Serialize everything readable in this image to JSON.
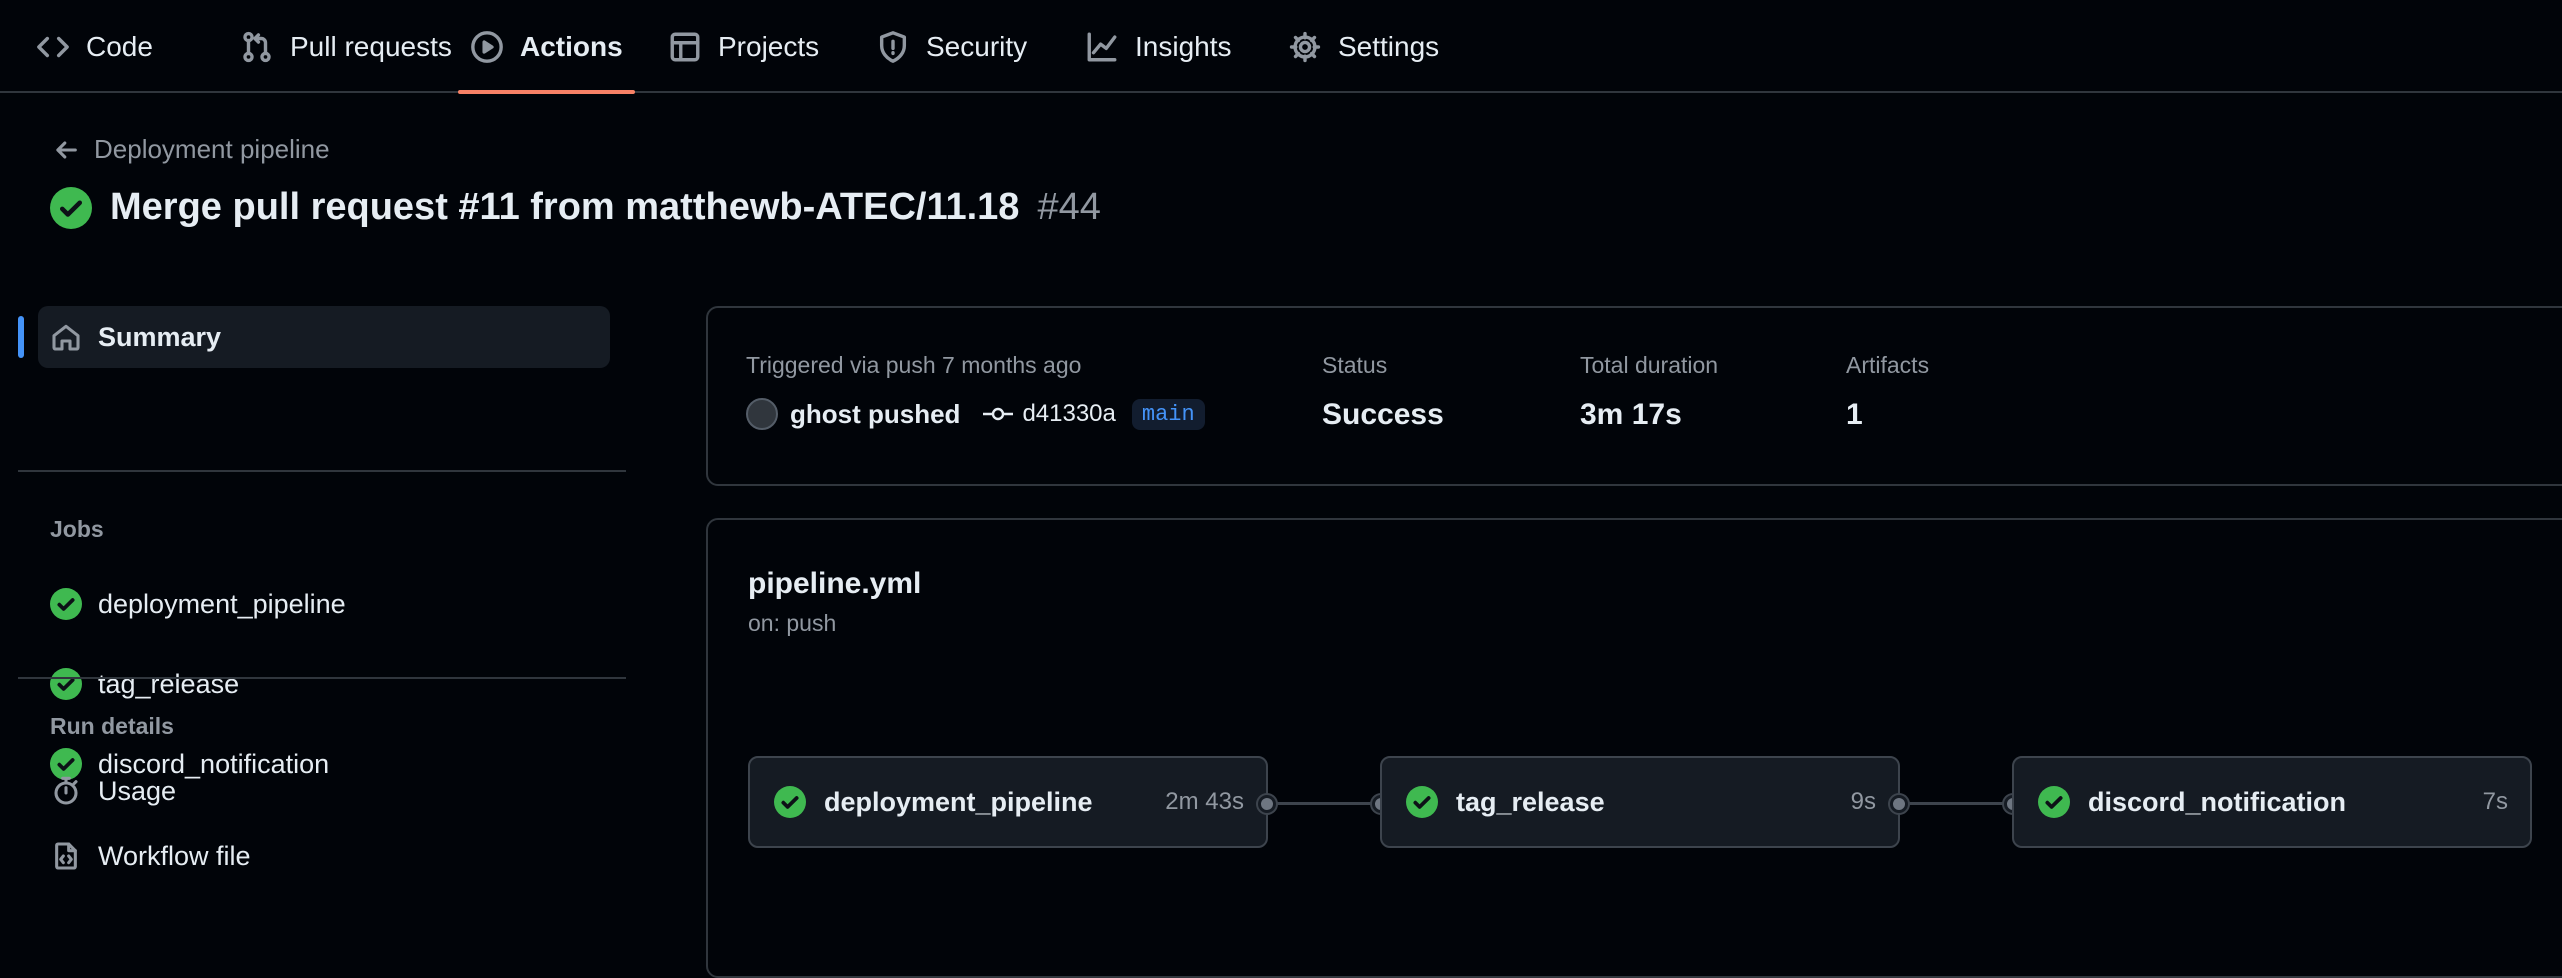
{
  "nav": {
    "tabs": [
      {
        "label": "Code",
        "icon": "code-icon"
      },
      {
        "label": "Pull requests",
        "icon": "git-pull-request-icon"
      },
      {
        "label": "Actions",
        "icon": "play-icon",
        "active": true
      },
      {
        "label": "Projects",
        "icon": "table-icon"
      },
      {
        "label": "Security",
        "icon": "shield-icon"
      },
      {
        "label": "Insights",
        "icon": "graph-icon"
      },
      {
        "label": "Settings",
        "icon": "gear-icon"
      }
    ]
  },
  "header": {
    "back_label": "Deployment pipeline",
    "title": "Merge pull request #11 from matthewb-ATEC/11.18",
    "run_number": "#44"
  },
  "sidebar": {
    "summary_label": "Summary",
    "jobs_heading": "Jobs",
    "jobs": [
      {
        "label": "deployment_pipeline",
        "status": "success"
      },
      {
        "label": "tag_release",
        "status": "success"
      },
      {
        "label": "discord_notification",
        "status": "success"
      }
    ],
    "run_details_heading": "Run details",
    "run_details": [
      {
        "label": "Usage",
        "icon": "stopwatch-icon"
      },
      {
        "label": "Workflow file",
        "icon": "file-code-icon"
      }
    ]
  },
  "summary": {
    "trigger_label": "Triggered via push 7 months ago",
    "actor": "ghost pushed",
    "commit": "d41330a",
    "branch": "main",
    "status_label": "Status",
    "status_value": "Success",
    "duration_label": "Total duration",
    "duration_value": "3m 17s",
    "artifacts_label": "Artifacts",
    "artifacts_value": "1"
  },
  "workflow": {
    "file": "pipeline.yml",
    "trigger": "on: push",
    "jobs": [
      {
        "name": "deployment_pipeline",
        "duration": "2m 43s"
      },
      {
        "name": "tag_release",
        "duration": "9s"
      },
      {
        "name": "discord_notification",
        "duration": "7s"
      }
    ]
  },
  "colors": {
    "background": "#010409",
    "success": "#3fb950",
    "active_tab_underline": "#f78166",
    "accent": "#4493f8",
    "muted_text": "#9198a1",
    "border": "#30363d"
  }
}
